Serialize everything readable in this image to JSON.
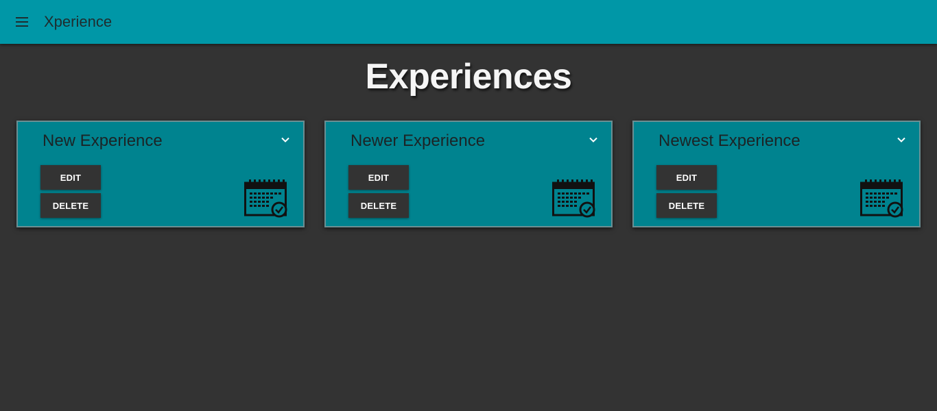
{
  "app": {
    "title": "Xperience",
    "menu_icon": "hamburger-menu-icon"
  },
  "page": {
    "title": "Experiences"
  },
  "cards": [
    {
      "title": "New Experience",
      "edit_label": "EDIT",
      "delete_label": "DELETE",
      "expand_icon": "chevron-down-icon",
      "icon": "calendar-check-icon"
    },
    {
      "title": "Newer Experience",
      "edit_label": "EDIT",
      "delete_label": "DELETE",
      "expand_icon": "chevron-down-icon",
      "icon": "calendar-check-icon"
    },
    {
      "title": "Newest Experience",
      "edit_label": "EDIT",
      "delete_label": "DELETE",
      "expand_icon": "chevron-down-icon",
      "icon": "calendar-check-icon"
    }
  ],
  "colors": {
    "appbar": "#0097a7",
    "card": "#00838f",
    "background": "#333333",
    "button": "#333333"
  }
}
